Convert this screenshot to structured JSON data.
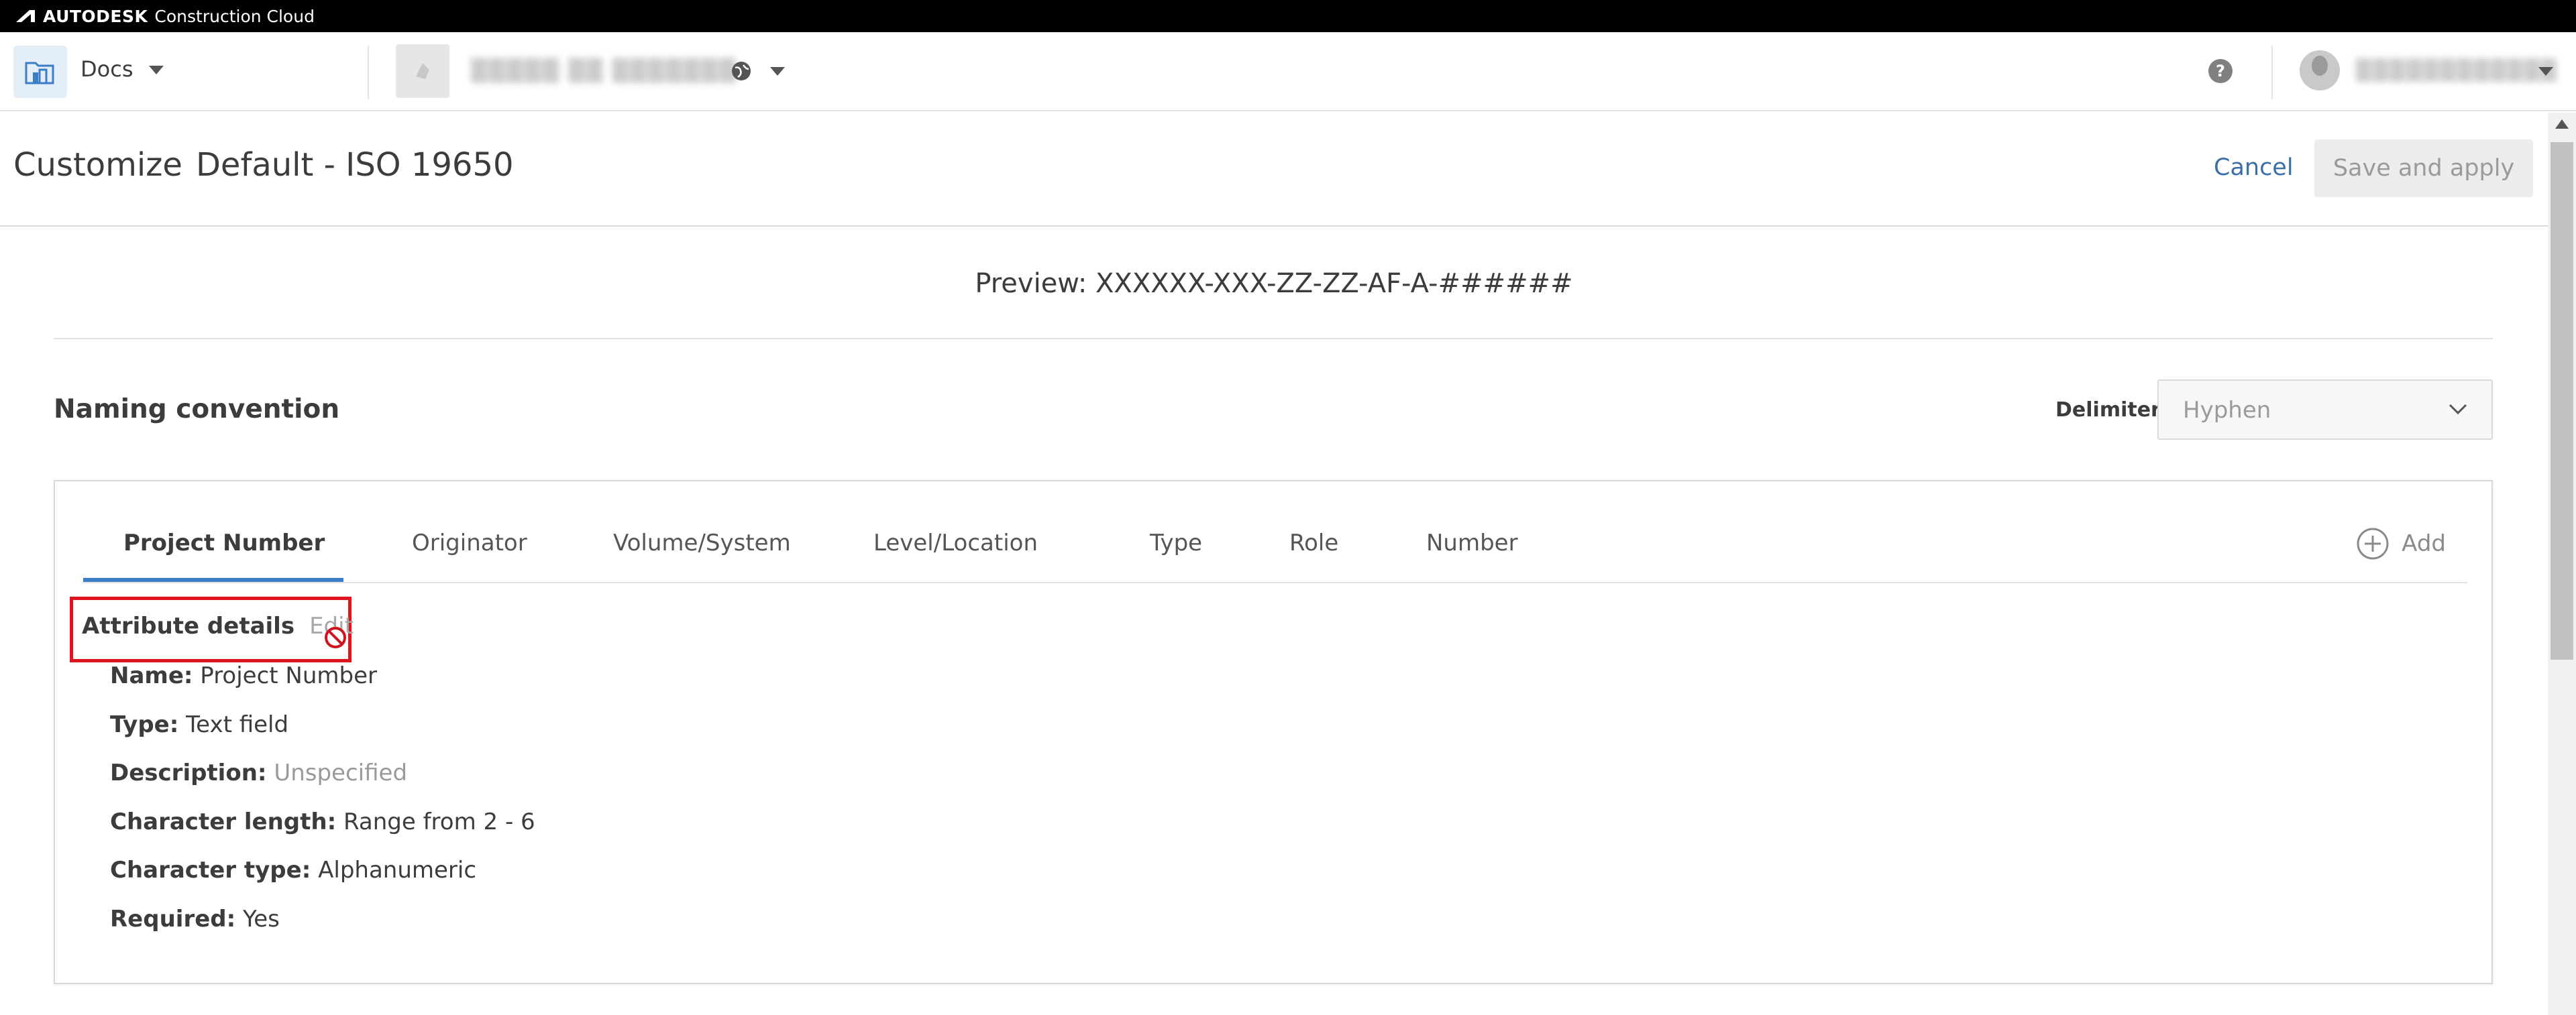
{
  "brand": {
    "company": "AUTODESK",
    "product": "Construction Cloud"
  },
  "header": {
    "module": "Docs",
    "project_name": "▒▒▒▒▒ ▒▒ ▒▒▒▒▒▒▒",
    "user_name": "▒▒▒▒▒▒▒▒▒▒▒▒",
    "help_glyph": "?"
  },
  "page": {
    "title_prefix": "Customize",
    "title_name": "Default - ISO 19650",
    "cancel_label": "Cancel",
    "save_label": "Save and apply"
  },
  "preview": {
    "text": "Preview: XXXXXX-XXX-ZZ-ZZ-AF-A-######"
  },
  "naming": {
    "title": "Naming convention",
    "delimiter_label": "Delimiter",
    "delimiter_value": "Hyphen"
  },
  "tabs": [
    {
      "label": "Project Number",
      "active": true
    },
    {
      "label": "Originator"
    },
    {
      "label": "Volume/System"
    },
    {
      "label": "Level/Location"
    },
    {
      "label": "Type"
    },
    {
      "label": "Role"
    },
    {
      "label": "Number"
    }
  ],
  "add_label": "Add",
  "attribute": {
    "title": "Attribute details",
    "edit_label": "Edit",
    "rows": [
      {
        "key": "Name:",
        "value": "Project Number"
      },
      {
        "key": "Type:",
        "value": "Text field"
      },
      {
        "key": "Description:",
        "value": "Unspecified",
        "muted": true
      },
      {
        "key": "Character length:",
        "value": "Range from 2 - 6"
      },
      {
        "key": "Character type:",
        "value": "Alphanumeric"
      },
      {
        "key": "Required:",
        "value": "Yes"
      }
    ]
  },
  "colors": {
    "accent": "#3a7dc9",
    "link": "#3b6fa8",
    "highlight": "#e0141e",
    "disabled_text": "#9a9a9a"
  },
  "icons": [
    "docs-module-icon",
    "chevron-down-icon",
    "globe-icon",
    "help-icon",
    "avatar",
    "add-circle-icon",
    "not-allowed-cursor-icon"
  ]
}
